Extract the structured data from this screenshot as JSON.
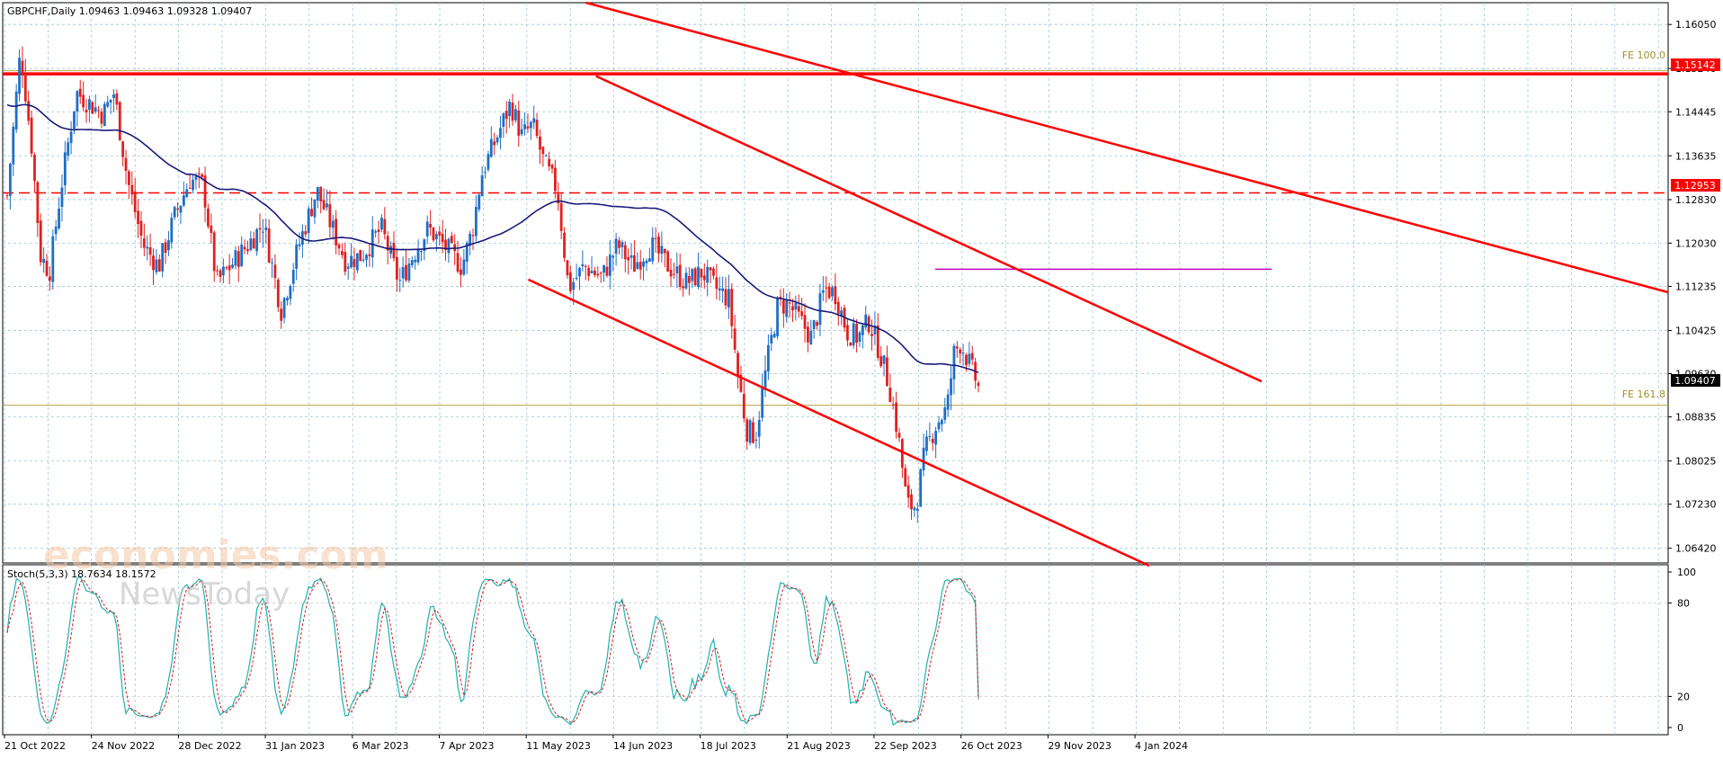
{
  "header": {
    "symbol_info": "GBPCHF,Daily  1.09463 1.09463 1.09328 1.09407"
  },
  "watermark": {
    "brand_top": "economies.com",
    "brand_bottom": "NewsToday"
  },
  "chart_data": {
    "type": "candlestick",
    "symbol": "GBPCHF",
    "timeframe": "Daily",
    "ohlc": {
      "open": 1.09463,
      "high": 1.09463,
      "low": 1.09328,
      "close": 1.09407
    },
    "price_axis": {
      "ylim": [
        1.0615,
        1.1645
      ],
      "ticks": [
        "1.16050",
        "1.15240",
        "1.14445",
        "1.13635",
        "1.12830",
        "1.12030",
        "1.11235",
        "1.10425",
        "1.09630",
        "1.08835",
        "1.08025",
        "1.07230",
        "1.06420"
      ]
    },
    "date_axis": {
      "ticks": [
        "21 Oct 2022",
        "24 Nov 2022",
        "28 Dec 2022",
        "31 Jan 2023",
        "6 Mar 2023",
        "7 Apr 2023",
        "11 May 2023",
        "14 Jun 2023",
        "18 Jul 2023",
        "21 Aug 2023",
        "22 Sep 2023",
        "26 Oct 2023",
        "29 Nov 2023",
        "4 Jan 2024"
      ]
    },
    "price_labels": {
      "upper_level": "1.15142",
      "dashed_level": "1.12953",
      "current": "1.09407"
    },
    "levels": [
      {
        "name": "FE 100.0",
        "price": 1.152,
        "color": "#b5a642"
      },
      {
        "name": "FE 161.8",
        "price": 1.0905,
        "color": "#b5a642"
      },
      {
        "name": "",
        "price": 1.15142,
        "color": "#ff0000",
        "style": "solid"
      },
      {
        "name": "",
        "price": 1.12953,
        "color": "#ff0000",
        "style": "dashed"
      },
      {
        "name": "",
        "price": 1.1155,
        "color": "#c000c0",
        "style": "segment"
      }
    ],
    "trendlines": [
      {
        "from": [
          "14 Jun 2023",
          1.151
        ],
        "to": [
          "29 Nov 2023",
          1.1155
        ],
        "color": "#ff0000"
      },
      {
        "from": [
          "18 May 2023",
          1.1136
        ],
        "to": [
          "16 Jan 2024",
          1.062
        ],
        "color": "#ff0000"
      },
      {
        "from": [
          "10 Jun 2023",
          1.1645
        ],
        "to": [
          "28 Mar 2024",
          1.1285
        ],
        "color": "#ff0000"
      }
    ],
    "moving_average": {
      "color": "#1a1a7a",
      "description": "slow moving average"
    },
    "colors": {
      "up": "#1e6fc4",
      "down": "#e02020",
      "stoch_main": "#20b0b0",
      "stoch_signal": "#d02020",
      "grid": "#9ec8d8"
    },
    "oscillator": {
      "label": "Stoch(5,3,3) 18.7634 18.1572",
      "name": "Stoch(5,3,3)",
      "main": 18.7634,
      "signal": 18.1572,
      "ylim": [
        0,
        100
      ],
      "ticks": [
        "100",
        "80",
        "20",
        "0"
      ]
    },
    "grid": true
  }
}
